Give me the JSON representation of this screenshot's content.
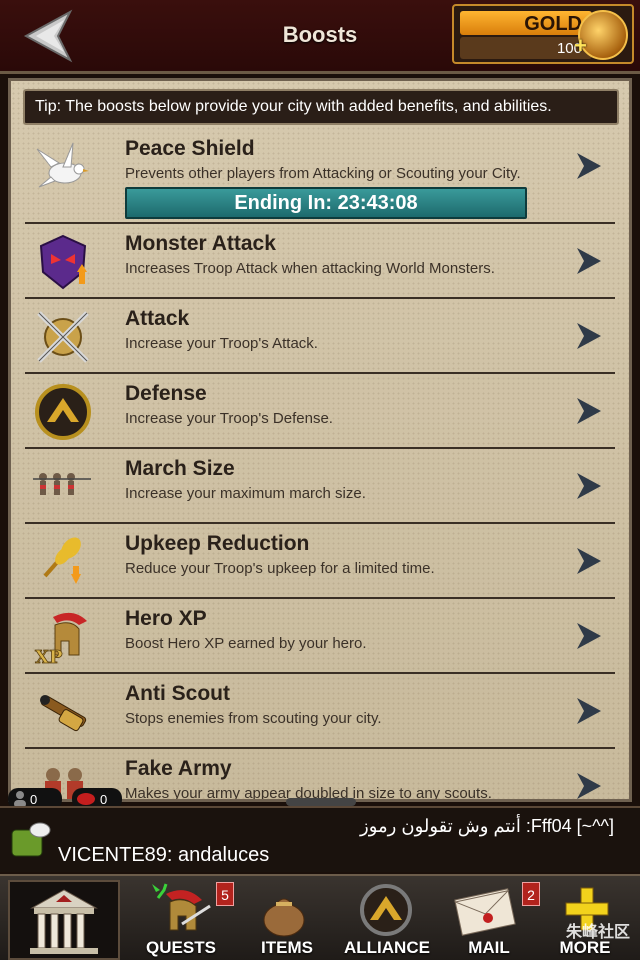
{
  "header": {
    "title": "Boosts",
    "gold_label": "GOLD",
    "gold_value": "100"
  },
  "tip": "Tip: The boosts below provide your city with added benefits, and abilities.",
  "boosts": [
    {
      "title": "Peace Shield",
      "desc": "Prevents other players from Attacking or Scouting your City.",
      "timer": "Ending In: 23:43:08",
      "icon": "dove-icon"
    },
    {
      "title": "Monster Attack",
      "desc": "Increases Troop Attack when attacking World Monsters.",
      "icon": "monster-icon"
    },
    {
      "title": "Attack",
      "desc": "Increase your Troop's Attack.",
      "icon": "crossed-swords-icon"
    },
    {
      "title": "Defense",
      "desc": "Increase your Troop's Defense.",
      "icon": "shield-icon"
    },
    {
      "title": "March Size",
      "desc": "Increase your maximum march size.",
      "icon": "soldiers-icon"
    },
    {
      "title": "Upkeep Reduction",
      "desc": "Reduce your Troop's upkeep for a limited time.",
      "icon": "wheat-icon"
    },
    {
      "title": "Hero XP",
      "desc": "Boost Hero XP earned by your hero.",
      "icon": "helmet-xp-icon"
    },
    {
      "title": "Anti Scout",
      "desc": "Stops enemies from scouting your city.",
      "icon": "spyglass-icon"
    },
    {
      "title": "Fake Army",
      "desc": "Makes your army appear doubled in size to any scouts.",
      "icon": "fake-army-icon"
    }
  ],
  "status": {
    "online": "0",
    "messages": "0"
  },
  "chat": {
    "line1": "أنتم وش تقولون رموز :Fff04 [~^^]",
    "line2": "VICENTE89: andaluces"
  },
  "nav": {
    "quests": "QUESTS",
    "quests_badge": "5",
    "items": "ITEMS",
    "alliance": "ALLIANCE",
    "mail": "MAIL",
    "mail_badge": "2",
    "more": "MORE"
  },
  "watermark": "朱峰社区"
}
